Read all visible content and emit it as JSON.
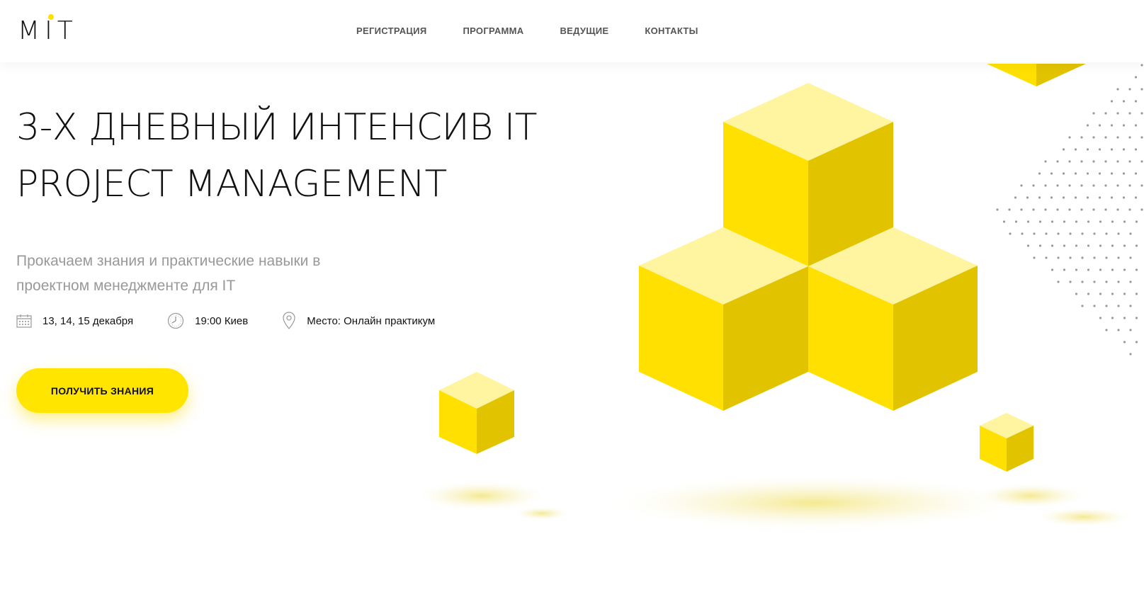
{
  "header": {
    "logo_text": "MIT",
    "nav": [
      {
        "label": "РЕГИСТРАЦИЯ"
      },
      {
        "label": "ПРОГРАММА"
      },
      {
        "label": "ВЕДУЩИЕ"
      },
      {
        "label": "КОНТАКТЫ"
      }
    ]
  },
  "hero": {
    "title_line1": "3-Х ДНЕВНЫЙ ИНТЕНСИВ IT",
    "title_line2": "PROJECT MANAGEMENT",
    "subtitle": "Прокачаем знания и практические навыки в проектном менеджменте для IT",
    "details": {
      "dates": "13, 14, 15 декабря",
      "time": "19:00 Киев",
      "place": "Место: Онлайн практикум"
    },
    "cta_label": "ПОЛУЧИТЬ ЗНАНИЯ"
  },
  "colors": {
    "accent": "#ffe500",
    "cube_top": "#fff5a0",
    "cube_left": "#ffe000",
    "cube_right": "#e2c300",
    "text_muted": "#999999",
    "dots": "#9a9a9a"
  },
  "icons": {
    "dates": "calendar-icon",
    "time": "clock-icon",
    "place": "location-pin-icon"
  }
}
